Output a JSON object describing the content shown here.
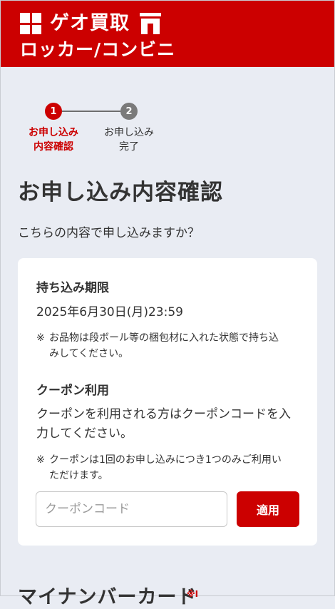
{
  "header": {
    "title_line1": "ゲオ買取",
    "title_line2": "ロッカー/コンビニ",
    "brand_color": "#cc0000"
  },
  "stepper": {
    "steps": [
      {
        "number": "1",
        "label_line1": "お申し込み",
        "label_line2": "内容確認",
        "state": "active"
      },
      {
        "number": "2",
        "label_line1": "お申し込み",
        "label_line2": "完了",
        "state": "inactive"
      }
    ]
  },
  "page": {
    "title": "お申し込み内容確認",
    "question": "こちらの内容で申し込みますか？"
  },
  "deadline": {
    "title": "持ち込み期限",
    "value": "2025年6月30日(月)23:59",
    "note_mark": "※",
    "note_line1": "お品物は段ボール等の梱包材に入れた状態で持ち込",
    "note_line2": "みしてください。"
  },
  "coupon": {
    "title": "クーポン利用",
    "desc_line1": "クーポンを利用される方はクーポンコードを入",
    "desc_line2": "力してください。",
    "note_mark": "※",
    "note_line1": "クーポンは1回のお申し込みにつき1つのみご利用い",
    "note_line2": "ただけます。",
    "input_placeholder": "クーポンコード",
    "input_value": "",
    "apply_label": "適用"
  },
  "next_section": {
    "title": "マイナンバーカード",
    "required_mark": "※I"
  }
}
